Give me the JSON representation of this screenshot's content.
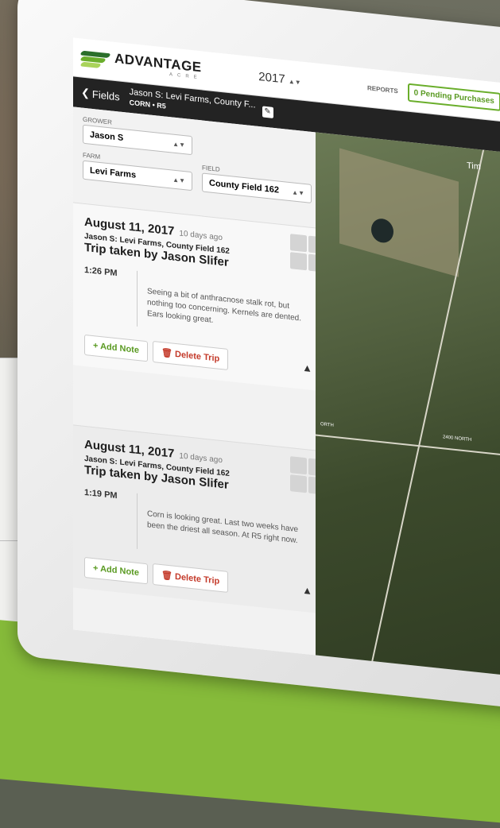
{
  "app": {
    "logo_text": "ADVANTAGE",
    "logo_subtext": "ACRE",
    "year_selector": "2017",
    "reports_label": "REPORTS",
    "pending_purchases": "0 Pending Purchases"
  },
  "nav": {
    "back_label": "Fields",
    "title": "Jason S: Levi Farms, County F...",
    "subtitle": "CORN • R5"
  },
  "filters": {
    "grower_label": "GROWER",
    "grower_value": "Jason S",
    "farm_label": "FARM",
    "farm_value": "Levi Farms",
    "field_label": "FIELD",
    "field_value": "County Field 162"
  },
  "trips": [
    {
      "date": "August 11, 2017",
      "ago": "10 days ago",
      "location": "Jason S: Levi Farms, County Field 162",
      "trip_by": "Trip taken by Jason Slifer",
      "time": "1:26 PM",
      "note": "Seeing a bit of anthracnose stalk rot, but nothing too concerning. Kernels are dented. Ears looking great.",
      "add_note": "+ Add Note",
      "delete_trip": "Delete Trip"
    },
    {
      "date": "August 11, 2017",
      "ago": "10 days ago",
      "location": "Jason S: Levi Farms, County Field 162",
      "trip_by": "Trip taken by Jason Slifer",
      "time": "1:19 PM",
      "note": "Corn is looking great. Last two weeks have been the driest all season. At R5 right now.",
      "add_note": "+ Add Note",
      "delete_trip": "Delete Trip"
    }
  ],
  "map": {
    "label_top": "Tim",
    "road_label_a": "2400 NORTH",
    "road_label_b": "ORTH"
  }
}
